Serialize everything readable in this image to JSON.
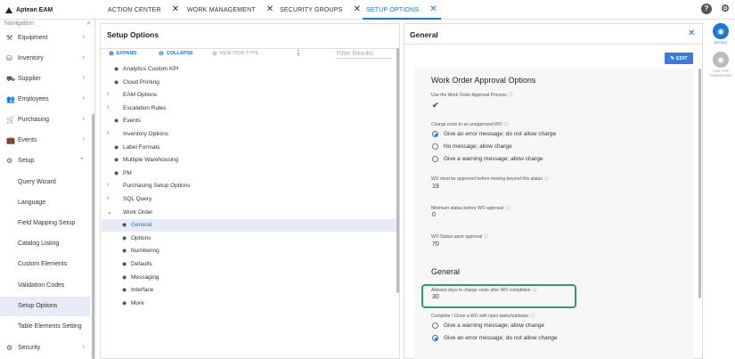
{
  "app": {
    "name": "Aptean EAM"
  },
  "tabs": [
    {
      "label": "ACTION CENTER",
      "close": "✕"
    },
    {
      "label": "WORK MANAGEMENT",
      "close": "✕"
    },
    {
      "label": "SECURITY GROUPS",
      "close": "✕"
    },
    {
      "label": "SETUP OPTIONS",
      "close": "✕"
    }
  ],
  "header_icons": {
    "help": "?",
    "settings": "⚙"
  },
  "nav": {
    "search_placeholder": "Navigation",
    "items": [
      {
        "label": "Equipment",
        "icon": "wrench-icon",
        "glyph": "⚒",
        "chev": "›"
      },
      {
        "label": "Inventory",
        "icon": "inventory-icon",
        "glyph": "⛁",
        "chev": "›"
      },
      {
        "label": "Supplier",
        "icon": "truck-icon",
        "glyph": "⛟",
        "chev": "›"
      },
      {
        "label": "Employees",
        "icon": "people-icon",
        "glyph": "👥",
        "chev": "›"
      },
      {
        "label": "Purchasing",
        "icon": "cart-icon",
        "glyph": "🛒",
        "chev": "›"
      },
      {
        "label": "Events",
        "icon": "briefcase-icon",
        "glyph": "💼",
        "chev": "›"
      },
      {
        "label": "Setup",
        "icon": "gear-icon",
        "glyph": "⚙",
        "chev": "⌃"
      }
    ],
    "sub_items": [
      "Query Wizard",
      "Language",
      "Field Mapping Setup",
      "Catalog Listing",
      "Custom Elements",
      "Validation Codes",
      "Setup Options",
      "Table Elements Setting"
    ],
    "bottom_item": {
      "label": "Security",
      "icon": "gear-icon",
      "glyph": "⚙",
      "chev": "›"
    }
  },
  "setup_options": {
    "title": "Setup Options",
    "expand_label": "EXPAND",
    "collapse_label": "COLLAPSE",
    "new_item_label": "NEW ITEM TYPE",
    "more": "⋮",
    "filter_placeholder": "Filter Results",
    "tree": [
      {
        "label": "Analytics Custom KPI",
        "kind": "eye"
      },
      {
        "label": "Cloud Printing",
        "kind": "eye"
      },
      {
        "label": "EAM Options",
        "kind": "arrow"
      },
      {
        "label": "Escalation Rules",
        "kind": "arrow"
      },
      {
        "label": "Events",
        "kind": "eye"
      },
      {
        "label": "Inventory Options",
        "kind": "arrow"
      },
      {
        "label": "Label Formats",
        "kind": "eye"
      },
      {
        "label": "Multiple Warehousing",
        "kind": "eye"
      },
      {
        "label": "PM",
        "kind": "eye"
      },
      {
        "label": "Purchasing Setup Options",
        "kind": "arrow"
      },
      {
        "label": "SQL Query",
        "kind": "arrow"
      },
      {
        "label": "Work Order",
        "kind": "open"
      },
      {
        "label": "General",
        "kind": "child-sel"
      },
      {
        "label": "Options",
        "kind": "child"
      },
      {
        "label": "Numbering",
        "kind": "child"
      },
      {
        "label": "Defaults",
        "kind": "child"
      },
      {
        "label": "Messaging",
        "kind": "child"
      },
      {
        "label": "Interface",
        "kind": "child"
      },
      {
        "label": "More",
        "kind": "child"
      }
    ]
  },
  "general": {
    "title": "General",
    "close": "✕",
    "edit_label": "EDIT",
    "sections": {
      "wo_approval": "Work Order Approval Options",
      "general": "General"
    },
    "fields": {
      "use_approval": {
        "label": "Use the Work Order Approval Process",
        "value": "✔"
      },
      "charge_costs": {
        "label": "Charge costs to an unapproved WO",
        "options": [
          {
            "label": "Give an error message; do not allow charge",
            "selected": true
          },
          {
            "label": "No message; allow charge",
            "selected": false
          },
          {
            "label": "Give a warning message; allow charge",
            "selected": false
          }
        ]
      },
      "approved_before": {
        "label": "WO must be approved before moving beyond this status",
        "value": "19"
      },
      "min_status": {
        "label": "Minimum status before WO approval",
        "value": "0"
      },
      "status_upon": {
        "label": "WO Status upon approval",
        "value": "70"
      },
      "allowed_days": {
        "label": "Allowed days to charge costs after WO completion",
        "value": "30"
      },
      "complete_close": {
        "label": "Complete / Close a WO with open tasks/subtasks",
        "options": [
          {
            "label": "Give a warning message; allow change",
            "selected": false
          },
          {
            "label": "Give an error message; do not allow change",
            "selected": true
          }
        ]
      }
    },
    "info_glyph": "ⓘ"
  },
  "side": {
    "details_label": "DETAILS",
    "item_type_label": "ITEM TYPE SUBMISSIONS"
  },
  "colors": {
    "accent": "#1976d2",
    "highlight": "#2e9a7a",
    "check": "#2e7d32"
  }
}
